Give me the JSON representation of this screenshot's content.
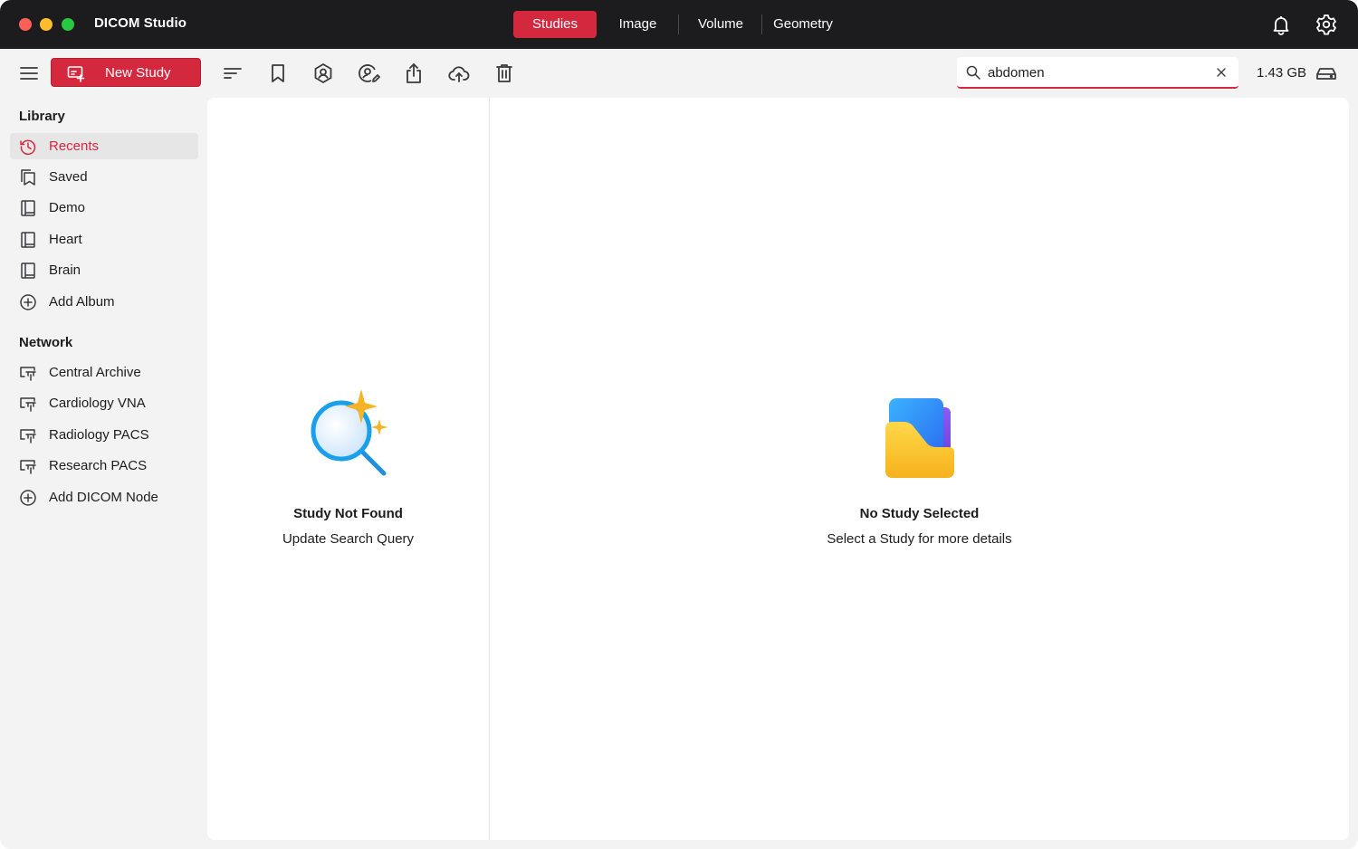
{
  "app": {
    "title": "DICOM Studio"
  },
  "tabs": [
    {
      "label": "Studies",
      "active": true
    },
    {
      "label": "Image",
      "active": false
    },
    {
      "label": "Volume",
      "active": false
    },
    {
      "label": "Geometry",
      "active": false
    }
  ],
  "titlebar_icons": [
    "bell-icon",
    "gear-icon"
  ],
  "toolbar": {
    "new_study_label": "New Study",
    "icons": [
      "menu-icon",
      "sort-icon",
      "bookmark-icon",
      "hexagon-user-icon",
      "edit-badge-icon",
      "share-icon",
      "cloud-upload-icon",
      "trash-icon"
    ],
    "search": {
      "value": "abdomen",
      "placeholder": ""
    },
    "storage": "1.43 GB"
  },
  "sidebar": {
    "library_title": "Library",
    "library": [
      {
        "label": "Recents",
        "icon": "history-icon",
        "selected": true
      },
      {
        "label": "Saved",
        "icon": "saved-icon",
        "selected": false
      },
      {
        "label": "Demo",
        "icon": "album-icon",
        "selected": false
      },
      {
        "label": "Heart",
        "icon": "album-icon",
        "selected": false
      },
      {
        "label": "Brain",
        "icon": "album-icon",
        "selected": false
      },
      {
        "label": "Add Album",
        "icon": "plus-circle-icon",
        "selected": false
      }
    ],
    "network_title": "Network",
    "network": [
      {
        "label": "Central Archive",
        "icon": "network-node-icon"
      },
      {
        "label": "Cardiology VNA",
        "icon": "network-node-icon"
      },
      {
        "label": "Radiology PACS",
        "icon": "network-node-icon"
      },
      {
        "label": "Research PACS",
        "icon": "network-node-icon"
      },
      {
        "label": "Add DICOM Node",
        "icon": "plus-circle-icon"
      }
    ]
  },
  "results_panel": {
    "title": "Study Not Found",
    "subtitle": "Update Search Query",
    "icon": "search-sparkle-icon"
  },
  "details_panel": {
    "title": "No Study Selected",
    "subtitle": "Select a Study for more details",
    "icon": "folder-icon"
  },
  "colors": {
    "accent": "#d4283f",
    "titlebar": "#1c1c1e",
    "sidebar_bg": "#f3f3f3"
  }
}
